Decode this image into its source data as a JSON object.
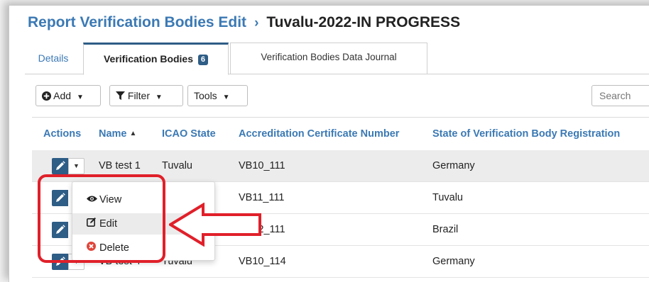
{
  "header": {
    "breadcrumb": "Report Verification Bodies Edit",
    "separator": "›",
    "current": "Tuvalu-2022-IN PROGRESS"
  },
  "tabs": [
    {
      "label": "Details",
      "active": false
    },
    {
      "label": "Verification Bodies",
      "count": "6",
      "active": true
    },
    {
      "label": "Verification Bodies Data Journal",
      "active": false
    }
  ],
  "toolbar": {
    "add_label": "Add",
    "filter_label": "Filter",
    "tools_label": "Tools",
    "search_placeholder": "Search"
  },
  "table": {
    "columns": [
      "Actions",
      "Name",
      "ICAO State",
      "Accreditation Certificate Number",
      "State of Verification Body Registration"
    ],
    "sorted_column": "Name",
    "rows": [
      {
        "name": "VB test 1",
        "icao_state": "Tuvalu",
        "cert": "VB10_111",
        "registration_state": "Germany"
      },
      {
        "name": "",
        "icao_state": "",
        "cert": "VB11_111",
        "registration_state": "Tuvalu"
      },
      {
        "name": "",
        "icao_state": "",
        "cert": "VB12_111",
        "registration_state": "Brazil"
      },
      {
        "name": "VB test 4",
        "icao_state": "Tuvalu",
        "cert": "VB10_114",
        "registration_state": "Germany"
      }
    ]
  },
  "row_menu": {
    "items": [
      {
        "label": "View",
        "icon": "eye-icon"
      },
      {
        "label": "Edit",
        "icon": "edit-icon"
      },
      {
        "label": "Delete",
        "icon": "delete-icon"
      }
    ],
    "highlighted": "Edit"
  },
  "colors": {
    "link": "#3b79b4",
    "primary_button": "#2e5d86",
    "annotation": "#e0202a",
    "delete_icon": "#e0453a"
  }
}
